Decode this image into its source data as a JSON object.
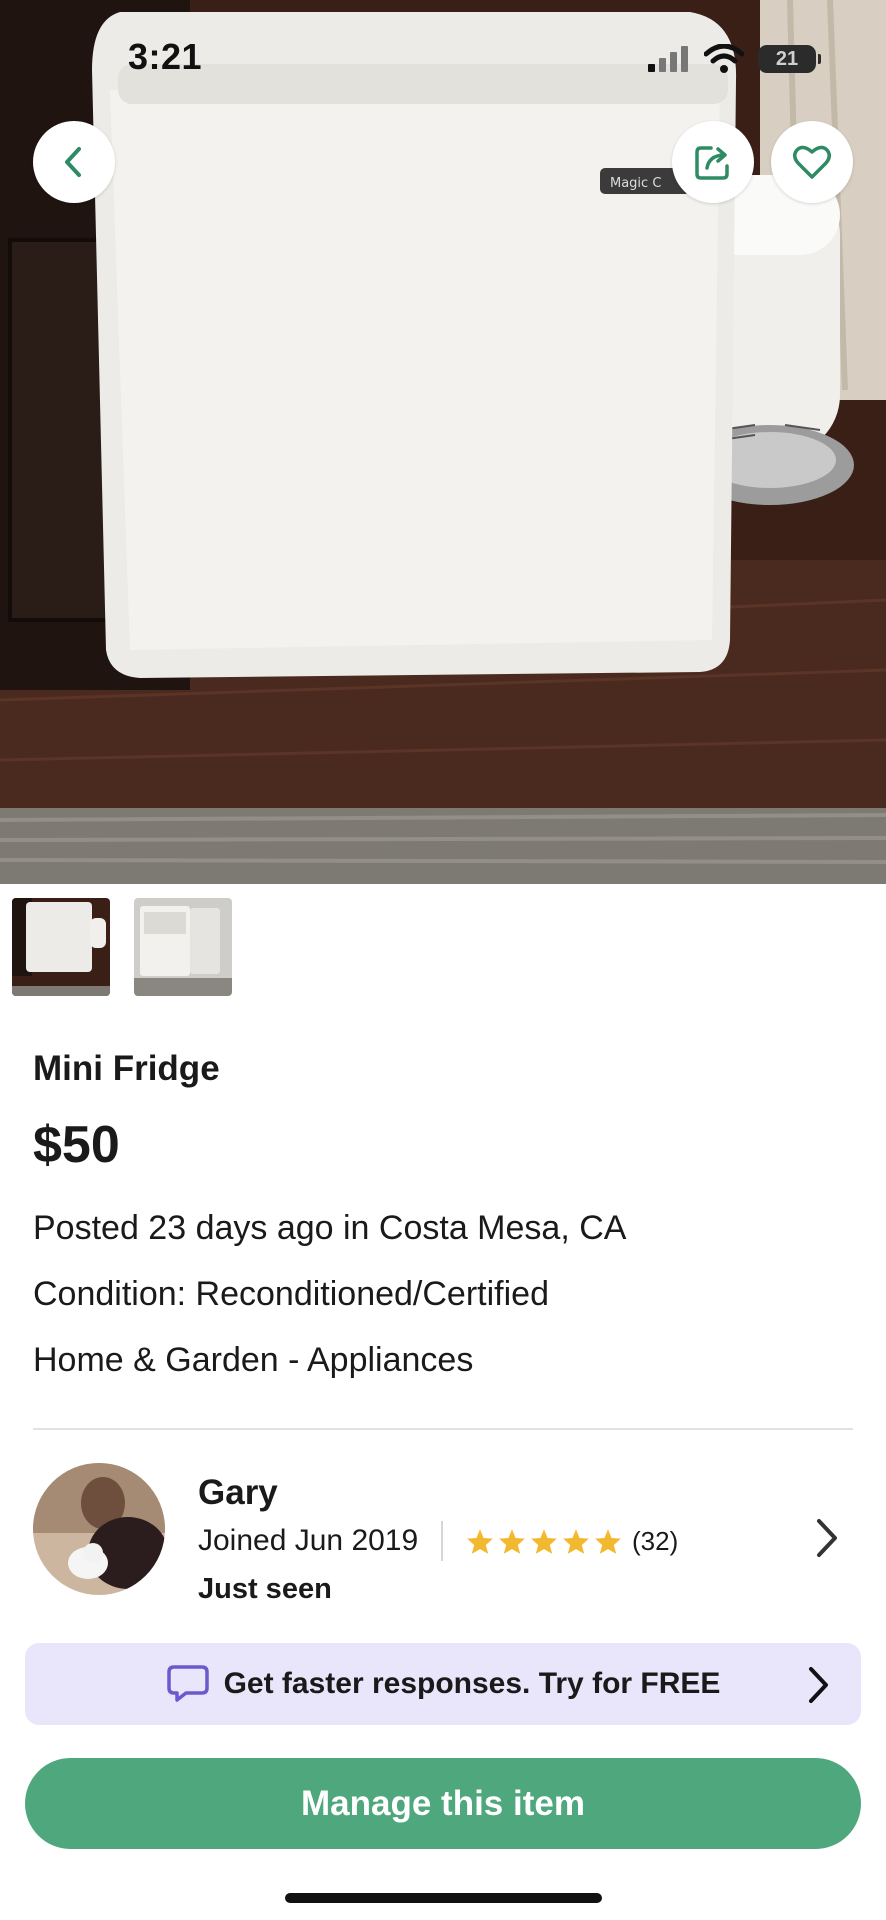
{
  "status_bar": {
    "time": "3:21",
    "battery": "21"
  },
  "hero": {
    "brand_badge": "Magic C"
  },
  "listing": {
    "title": "Mini Fridge",
    "price": "$50",
    "posted": "Posted 23 days ago in Costa Mesa, CA",
    "condition": "Condition: Reconditioned/Certified",
    "category": "Home & Garden - Appliances",
    "photo_count": 2
  },
  "seller": {
    "name": "Gary",
    "joined": "Joined Jun 2019",
    "rating_stars": 5,
    "review_count": "(32)",
    "last_seen": "Just seen"
  },
  "promo": {
    "text": "Get faster responses. Try for FREE"
  },
  "actions": {
    "manage_label": "Manage this item"
  },
  "colors": {
    "accent_green": "#4fa77d",
    "promo_bg": "#e9e6fb",
    "promo_icon": "#6a5acd",
    "star": "#f2b82f",
    "icon_green": "#2e8b63"
  },
  "icons": {
    "back": "chevron-left-icon",
    "share": "share-icon",
    "favorite": "heart-icon",
    "seller_link": "chevron-right-icon",
    "promo": "chat-bubble-icon"
  }
}
